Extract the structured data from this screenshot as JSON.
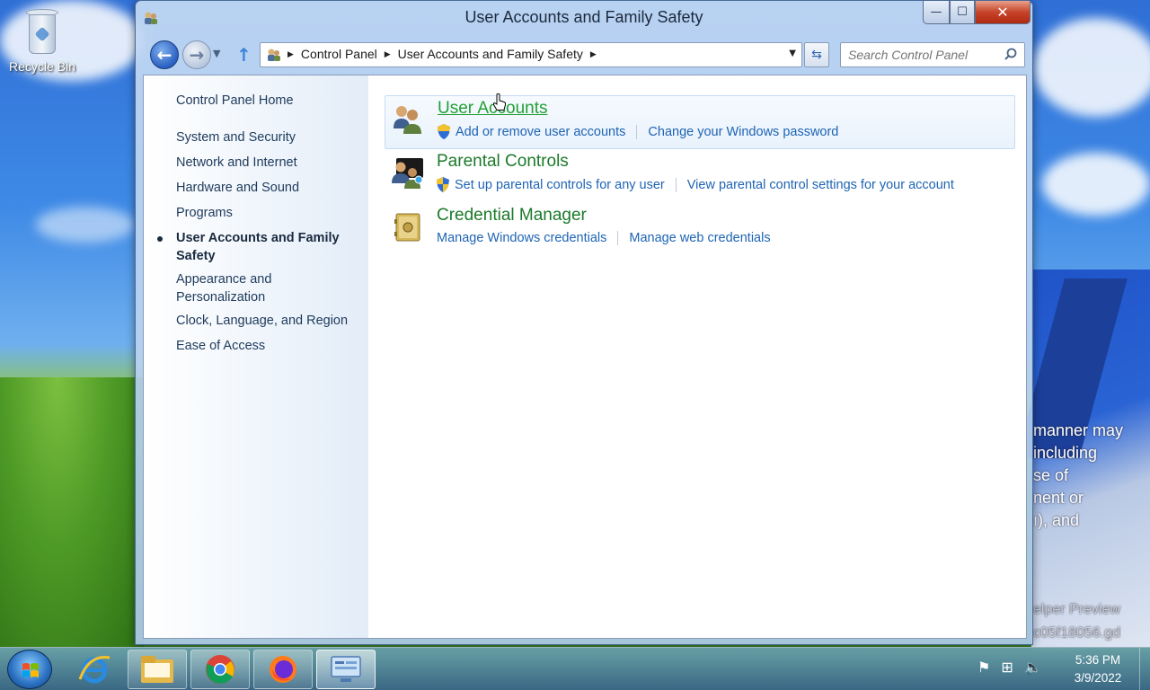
{
  "desktop": {
    "recycle_bin_label": "Recycle Bin",
    "background_text": [
      "manner may",
      "including",
      "se of",
      "nent or",
      "ı), and"
    ],
    "background_text_dim": [
      "elper Preview",
      "c05f18056.gd"
    ]
  },
  "window": {
    "title": "User Accounts and Family Safety",
    "caption": {
      "minimize": "—",
      "maximize": "☐",
      "close": "✕"
    }
  },
  "navbar": {
    "breadcrumbs": [
      "Control Panel",
      "User Accounts and Family Safety"
    ],
    "search_placeholder": "Search Control Panel"
  },
  "sidebar": {
    "home": "Control Panel Home",
    "items": [
      {
        "label": "System and Security"
      },
      {
        "label": "Network and Internet"
      },
      {
        "label": "Hardware and Sound"
      },
      {
        "label": "Programs"
      },
      {
        "label": "User Accounts and Family Safety",
        "current": true
      },
      {
        "label": "Appearance and Personalization"
      },
      {
        "label": "Clock, Language, and Region"
      },
      {
        "label": "Ease of Access"
      }
    ]
  },
  "categories": [
    {
      "title": "User Accounts",
      "icon": "users-icon",
      "links": [
        {
          "label": "Add or remove user accounts",
          "shield": true
        },
        {
          "label": "Change your Windows password",
          "shield": false
        }
      ]
    },
    {
      "title": "Parental Controls",
      "icon": "parental-controls-icon",
      "links": [
        {
          "label": "Set up parental controls for any user",
          "shield": true
        },
        {
          "label": "View parental control settings for your account",
          "shield": false
        }
      ]
    },
    {
      "title": "Credential Manager",
      "icon": "credential-vault-icon",
      "links": [
        {
          "label": "Manage Windows credentials",
          "shield": false
        },
        {
          "label": "Manage web credentials",
          "shield": false
        }
      ]
    }
  ],
  "taskbar": {
    "apps": [
      "start-button",
      "internet-explorer-icon",
      "file-explorer-icon",
      "chrome-icon",
      "firefox-icon",
      "control-panel-icon"
    ],
    "time": "5:36 PM",
    "date": "3/9/2022"
  },
  "colors": {
    "category_title": "#1b7a2a",
    "link": "#1e64b4",
    "window_frame": "#b0ccee"
  }
}
